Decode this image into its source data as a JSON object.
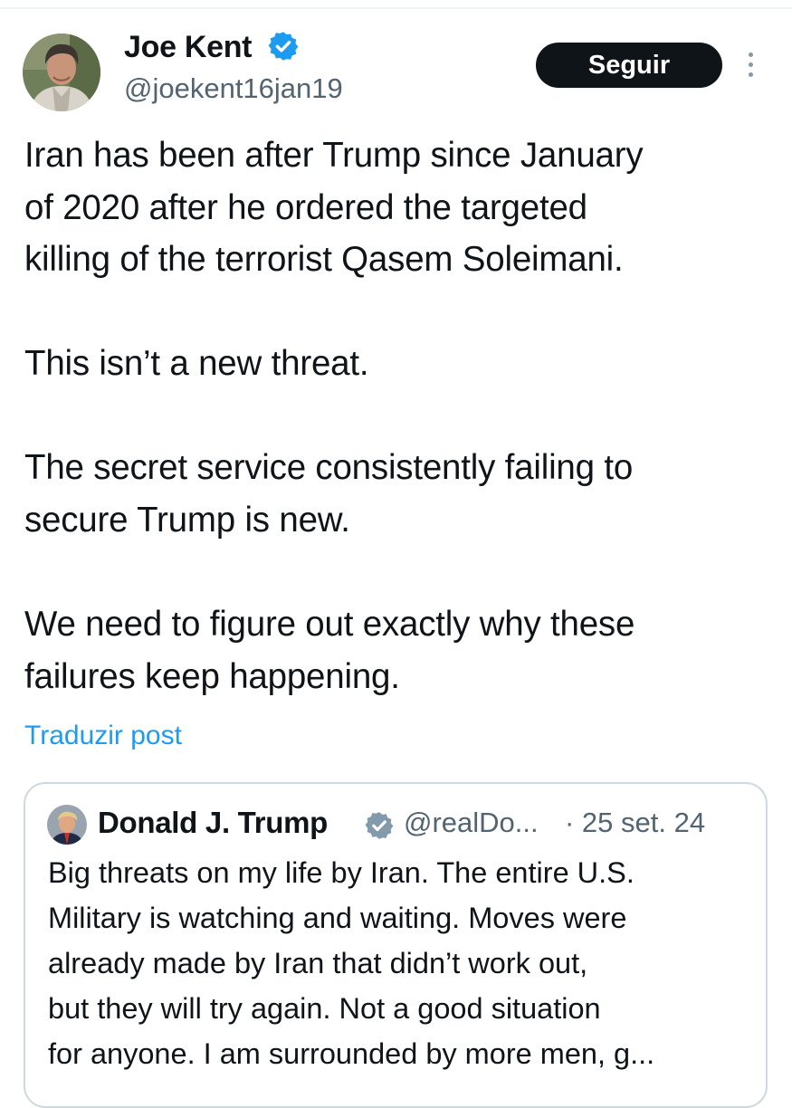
{
  "author": {
    "name": "Joe Kent",
    "handle": "@joekent16jan19",
    "verified": true,
    "avatar_icon": "profile-photo"
  },
  "actions": {
    "follow_label": "Seguir",
    "more_icon": "more-vertical-icon"
  },
  "post": {
    "paragraphs": [
      "Iran has been after Trump since January\nof 2020 after he ordered the targeted\nkilling of the terrorist Qasem Soleimani.",
      "This isn’t a new threat.",
      "The secret service consistently failing to\nsecure Trump is new.",
      "We need to figure out exactly why these\nfailures keep happening."
    ],
    "translate_label": "Traduzir post"
  },
  "quote": {
    "name": "Donald J. Trump",
    "verified": true,
    "handle": "@realDo...",
    "date": "· 25 set. 24",
    "text": "Big threats on my life by Iran. The entire U.S.\nMilitary is watching and waiting. Moves were\nalready made by Iran that didn’t work out,\nbut they will try again. Not a good situation\nfor anyone. I am surrounded by more men, g..."
  },
  "colors": {
    "accent": "#1d9bf0",
    "text": "#0f1419",
    "secondary": "#536471",
    "border": "#cfd9de",
    "button": "#0f1419"
  }
}
